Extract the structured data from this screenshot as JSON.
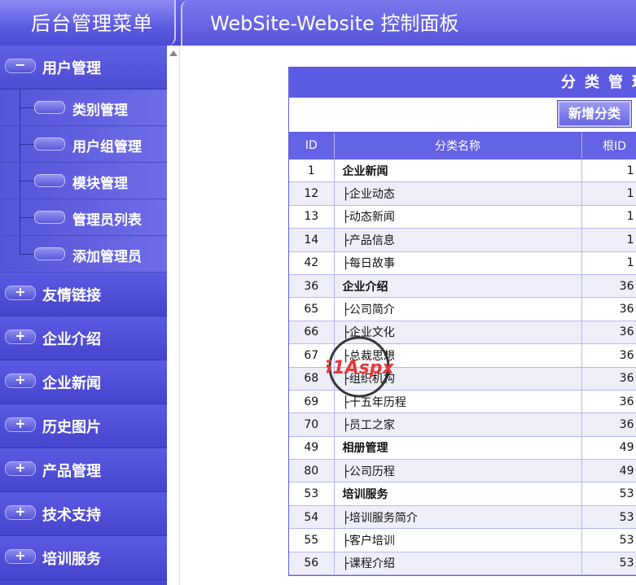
{
  "header": {
    "menu_title": "后台管理菜单",
    "panel_title": "WebSite-Website 控制面板"
  },
  "sidebar": {
    "open_group": {
      "label": "用户管理",
      "toggle": "−"
    },
    "sub_items": [
      {
        "label": "类别管理"
      },
      {
        "label": "用户组管理"
      },
      {
        "label": "模块管理"
      },
      {
        "label": "管理员列表"
      },
      {
        "label": "添加管理员"
      }
    ],
    "groups": [
      {
        "label": "友情链接",
        "toggle": "+"
      },
      {
        "label": "企业介绍",
        "toggle": "+"
      },
      {
        "label": "企业新闻",
        "toggle": "+"
      },
      {
        "label": "历史图片",
        "toggle": "+"
      },
      {
        "label": "产品管理",
        "toggle": "+"
      },
      {
        "label": "技术支持",
        "toggle": "+"
      },
      {
        "label": "培训服务",
        "toggle": "+"
      }
    ]
  },
  "panel": {
    "title": "分类管理",
    "add_button": "新增分类",
    "columns": {
      "id": "ID",
      "name": "分类名称",
      "root": "根ID"
    },
    "rows": [
      {
        "id": "1",
        "name": "企业新闻",
        "root": "1",
        "top": true
      },
      {
        "id": "12",
        "name": "├企业动态",
        "root": "1",
        "top": false
      },
      {
        "id": "13",
        "name": "├动态新闻",
        "root": "1",
        "top": false
      },
      {
        "id": "14",
        "name": "├产品信息",
        "root": "1",
        "top": false
      },
      {
        "id": "42",
        "name": "├每日故事",
        "root": "1",
        "top": false
      },
      {
        "id": "36",
        "name": "企业介绍",
        "root": "36",
        "top": true
      },
      {
        "id": "65",
        "name": "├公司简介",
        "root": "36",
        "top": false
      },
      {
        "id": "66",
        "name": "├企业文化",
        "root": "36",
        "top": false
      },
      {
        "id": "67",
        "name": "├总裁思想",
        "root": "36",
        "top": false
      },
      {
        "id": "68",
        "name": "├组织机构",
        "root": "36",
        "top": false
      },
      {
        "id": "69",
        "name": "├十五年历程",
        "root": "36",
        "top": false
      },
      {
        "id": "70",
        "name": "├员工之家",
        "root": "36",
        "top": false
      },
      {
        "id": "49",
        "name": "相册管理",
        "root": "49",
        "top": true
      },
      {
        "id": "80",
        "name": "├公司历程",
        "root": "49",
        "top": false
      },
      {
        "id": "53",
        "name": "培训服务",
        "root": "53",
        "top": true
      },
      {
        "id": "54",
        "name": "├培训服务简介",
        "root": "53",
        "top": false
      },
      {
        "id": "55",
        "name": "├客户培训",
        "root": "53",
        "top": false
      },
      {
        "id": "56",
        "name": "├课程介绍",
        "root": "53",
        "top": false
      }
    ]
  },
  "watermark": {
    "text": "51Aspx"
  }
}
